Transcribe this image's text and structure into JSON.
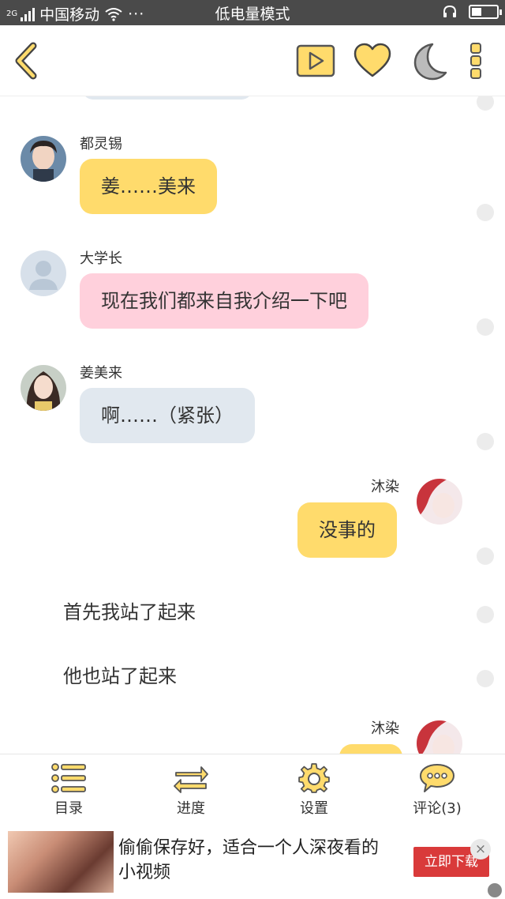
{
  "status_bar": {
    "network": "2G",
    "carrier": "中国移动",
    "more": "···",
    "mode": "低电量模式",
    "battery_level": 0.4
  },
  "toolbar": {
    "back_icon": "chevron-left-icon",
    "icons": [
      "play-icon",
      "heart-icon",
      "moon-icon",
      "more-vertical-icon"
    ]
  },
  "colors": {
    "accent_yellow": "#ffdb6c",
    "pink_bubble": "#ffd0dc",
    "blue_bubble": "#e1e8ef",
    "dot_gray": "#ececec"
  },
  "messages": [
    {
      "type": "left",
      "name": "都灵锡",
      "text": "姜……美来",
      "bubble": "yellow"
    },
    {
      "type": "left",
      "name": "大学长",
      "text": "现在我们都来自我介绍一下吧",
      "bubble": "pink"
    },
    {
      "type": "left",
      "name": "姜美来",
      "text": "啊……（紧张）",
      "bubble": "blue"
    },
    {
      "type": "right",
      "name": "沐染",
      "text": "没事的",
      "bubble": "yellow"
    },
    {
      "type": "narration",
      "text": "首先我站了起来"
    },
    {
      "type": "narration",
      "text": "他也站了起来"
    },
    {
      "type": "right",
      "name": "沐染",
      "text": "",
      "bubble": "yellow"
    }
  ],
  "bottom_nav": [
    {
      "label": "目录",
      "icon": "list-icon"
    },
    {
      "label": "进度",
      "icon": "swap-arrows-icon"
    },
    {
      "label": "设置",
      "icon": "gear-icon"
    },
    {
      "label": "评论(3)",
      "icon": "comment-icon"
    }
  ],
  "ad": {
    "text": "偷偷保存好，适合一个人深夜看的小视频",
    "button": "立即下载",
    "close": "×"
  }
}
